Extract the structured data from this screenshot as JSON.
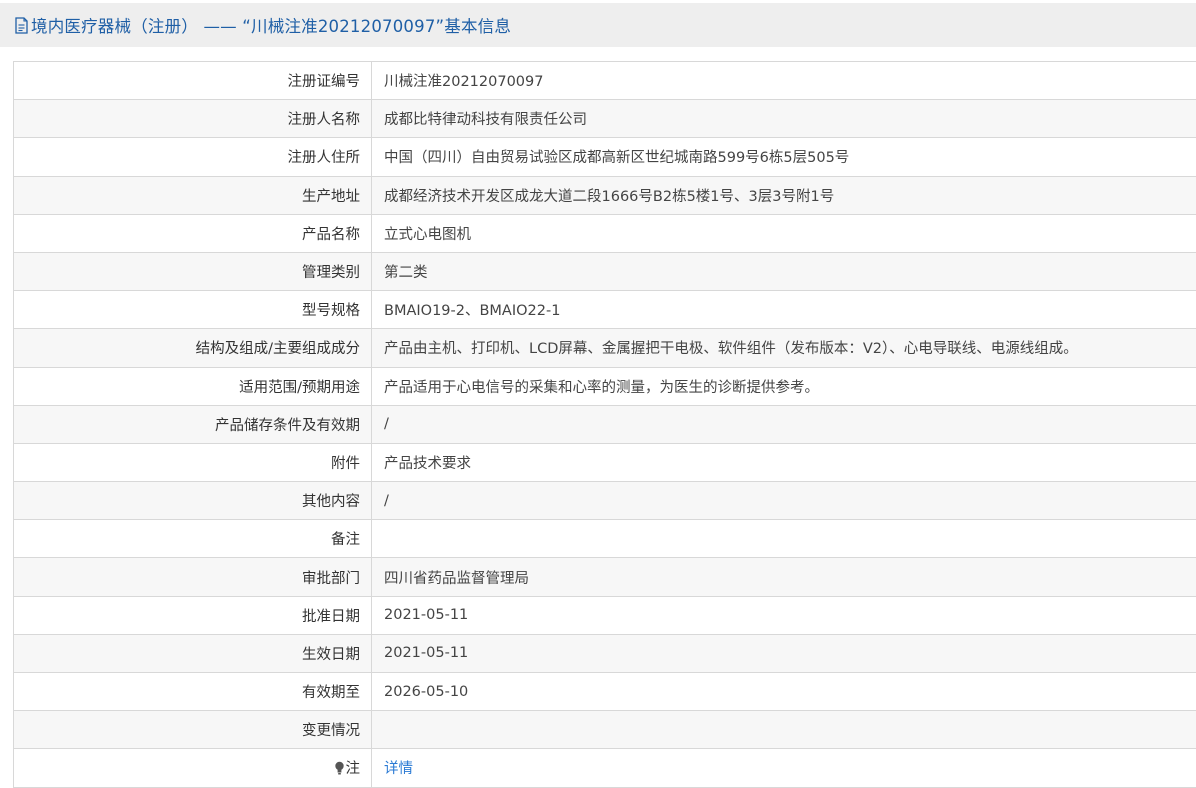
{
  "header": {
    "title": "境内医疗器械（注册） —— “川械注准20212070097”基本信息",
    "icon": "document-icon"
  },
  "rows": [
    {
      "label": "注册证编号",
      "value": "川械注准20212070097"
    },
    {
      "label": "注册人名称",
      "value": "成都比特律动科技有限责任公司"
    },
    {
      "label": "注册人住所",
      "value": "中国（四川）自由贸易试验区成都高新区世纪城南路599号6栋5层505号"
    },
    {
      "label": "生产地址",
      "value": "成都经济技术开发区成龙大道二段1666号B2栋5楼1号、3层3号附1号"
    },
    {
      "label": "产品名称",
      "value": "立式心电图机"
    },
    {
      "label": "管理类别",
      "value": "第二类"
    },
    {
      "label": "型号规格",
      "value": "BMAIO19-2、BMAIO22-1"
    },
    {
      "label": "结构及组成/主要组成成分",
      "value": "产品由主机、打印机、LCD屏幕、金属握把干电极、软件组件（发布版本：V2）、心电导联线、电源线组成。"
    },
    {
      "label": "适用范围/预期用途",
      "value": "产品适用于心电信号的采集和心率的测量，为医生的诊断提供参考。"
    },
    {
      "label": "产品储存条件及有效期",
      "value": "/"
    },
    {
      "label": "附件",
      "value": "产品技术要求"
    },
    {
      "label": "其他内容",
      "value": "/"
    },
    {
      "label": "备注",
      "value": ""
    },
    {
      "label": "审批部门",
      "value": "四川省药品监督管理局"
    },
    {
      "label": "批准日期",
      "value": "2021-05-11"
    },
    {
      "label": "生效日期",
      "value": "2021-05-11"
    },
    {
      "label": "有效期至",
      "value": "2026-05-10"
    },
    {
      "label": "变更情况",
      "value": ""
    }
  ],
  "note_row": {
    "icon": "lightbulb-icon",
    "label": "注",
    "link_text": "详情"
  },
  "colors": {
    "title": "#1f5fa6",
    "link": "#2a7ad4",
    "header_bg": "#eeeeee",
    "border": "#d8d8d8"
  }
}
